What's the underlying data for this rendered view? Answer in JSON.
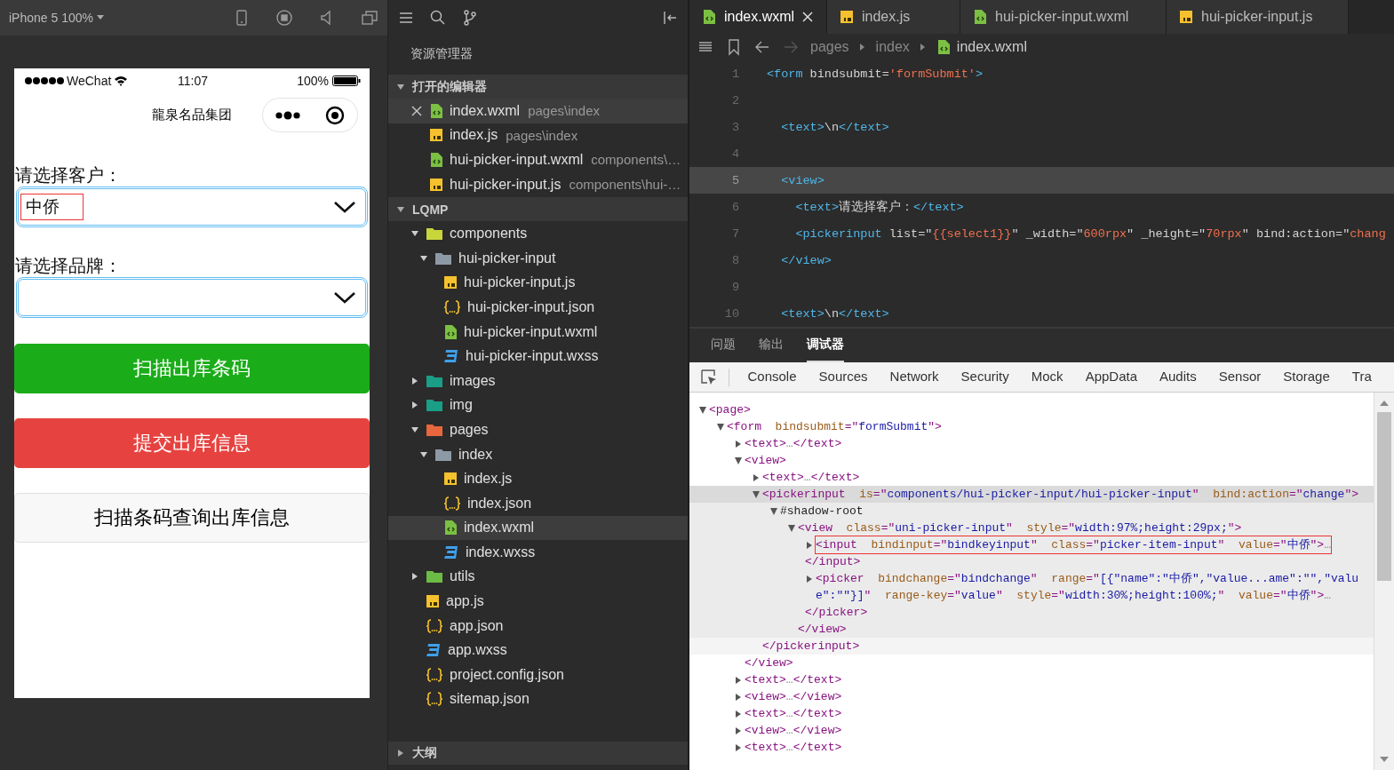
{
  "simulator": {
    "device_label": "iPhone 5 100%",
    "status_bar": {
      "carrier": "WeChat",
      "time": "11:07",
      "battery": "100%"
    },
    "nav_title": "龍泉名品集团",
    "fields": [
      {
        "label": "请选择客户：",
        "value": "中侨",
        "outlined": true
      },
      {
        "label": "请选择品牌：",
        "outlined": false
      }
    ],
    "buttons": [
      {
        "label": "扫描出库条码",
        "kind": "primary"
      },
      {
        "label": "提交出库信息",
        "kind": "warn"
      },
      {
        "label": "扫描条码查询出库信息",
        "kind": "default"
      }
    ]
  },
  "explorer": {
    "title": "资源管理器",
    "open_editors": {
      "title": "打开的编辑器",
      "expanded": true,
      "items": [
        {
          "name": "index.wxml",
          "path": "pages\\index",
          "kind": "wxml",
          "selected": true
        },
        {
          "name": "index.js",
          "path": "pages\\index",
          "kind": "js",
          "selected": false
        },
        {
          "name": "hui-picker-input.wxml",
          "path": "components\\…",
          "kind": "wxml",
          "selected": false
        },
        {
          "name": "hui-picker-input.js",
          "path": "components\\hui-…",
          "kind": "js",
          "selected": false
        }
      ]
    },
    "project": {
      "title": "LQMP",
      "expanded": true,
      "items": [
        {
          "name": "components",
          "kind": "folder",
          "color": "#c8d63c",
          "expanded": true,
          "selected": false,
          "children": [
            {
              "name": "hui-picker-input",
              "kind": "folder",
              "color": "#8d9aa5",
              "expanded": true,
              "selected": false,
              "children": [
                {
                  "name": "hui-picker-input.js",
                  "kind": "js",
                  "selected": false
                },
                {
                  "name": "hui-picker-input.json",
                  "kind": "json",
                  "selected": false
                },
                {
                  "name": "hui-picker-input.wxml",
                  "kind": "wxml",
                  "selected": false
                },
                {
                  "name": "hui-picker-input.wxss",
                  "kind": "wxss",
                  "selected": false
                }
              ]
            }
          ]
        },
        {
          "name": "images",
          "kind": "folder",
          "color": "#1a9e86",
          "expanded": false,
          "selected": false
        },
        {
          "name": "img",
          "kind": "folder",
          "color": "#1a9e86",
          "expanded": false,
          "selected": false
        },
        {
          "name": "pages",
          "kind": "folder",
          "color": "#e8673c",
          "expanded": true,
          "selected": false,
          "children": [
            {
              "name": "index",
              "kind": "folder",
              "color": "#8d9aa5",
              "expanded": true,
              "selected": false,
              "children": [
                {
                  "name": "index.js",
                  "kind": "js",
                  "selected": false
                },
                {
                  "name": "index.json",
                  "kind": "json",
                  "selected": false
                },
                {
                  "name": "index.wxml",
                  "kind": "wxml",
                  "selected": true
                },
                {
                  "name": "index.wxss",
                  "kind": "wxss",
                  "selected": false
                }
              ]
            }
          ]
        },
        {
          "name": "utils",
          "kind": "folder",
          "color": "#6cbb45",
          "expanded": false,
          "selected": false
        },
        {
          "name": "app.js",
          "kind": "js",
          "selected": false
        },
        {
          "name": "app.json",
          "kind": "json",
          "selected": false
        },
        {
          "name": "app.wxss",
          "kind": "wxss",
          "selected": false
        },
        {
          "name": "project.config.json",
          "kind": "json",
          "selected": false
        },
        {
          "name": "sitemap.json",
          "kind": "json",
          "selected": false
        }
      ]
    },
    "outline": {
      "title": "大纲",
      "expanded": false
    }
  },
  "editor": {
    "tabs": [
      {
        "label": "index.wxml",
        "kind": "wxml",
        "selected": true
      },
      {
        "label": "index.js",
        "kind": "js",
        "selected": false
      },
      {
        "label": "hui-picker-input.wxml",
        "kind": "wxml",
        "selected": false
      },
      {
        "label": "hui-picker-input.js",
        "kind": "js",
        "selected": false
      }
    ],
    "breadcrumb": [
      {
        "label": "pages"
      },
      {
        "label": "index"
      },
      {
        "label": "index.wxml",
        "kind": "wxml"
      }
    ],
    "lines": [
      {
        "number": "1",
        "current": false,
        "tokens": [
          {
            "kind": "tag",
            "text": "<form"
          },
          {
            "kind": "plain",
            "text": " bindsubmit="
          },
          {
            "kind": "str",
            "text": "'formSubmit'"
          },
          {
            "kind": "tag",
            "text": ">"
          }
        ]
      },
      {
        "number": "2",
        "current": false
      },
      {
        "number": "3",
        "current": false,
        "tokens": [
          {
            "kind": "tag",
            "text": "  <text>"
          },
          {
            "kind": "plain",
            "text": "\\n"
          },
          {
            "kind": "tag",
            "text": "</text>"
          }
        ]
      },
      {
        "number": "4",
        "current": false
      },
      {
        "number": "5",
        "current": true,
        "tokens": [
          {
            "kind": "tag",
            "text": "  <view>"
          }
        ]
      },
      {
        "number": "6",
        "current": false,
        "tokens": [
          {
            "kind": "tag",
            "text": "    <text>"
          },
          {
            "kind": "plain",
            "text": "请选择客户："
          },
          {
            "kind": "tag",
            "text": "</text>"
          }
        ]
      },
      {
        "number": "7",
        "current": false,
        "tokens": [
          {
            "kind": "tag",
            "text": "    <pickerinput"
          },
          {
            "kind": "plain",
            "text": " list=\""
          },
          {
            "kind": "str",
            "text": "{{select1}}"
          },
          {
            "kind": "plain",
            "text": "\" _width=\""
          },
          {
            "kind": "str",
            "text": "600rpx"
          },
          {
            "kind": "plain",
            "text": "\" _height=\""
          },
          {
            "kind": "str",
            "text": "70rpx"
          },
          {
            "kind": "plain",
            "text": "\" bind:action=\""
          },
          {
            "kind": "str",
            "text": "chang"
          }
        ]
      },
      {
        "number": "8",
        "current": false,
        "tokens": [
          {
            "kind": "tag",
            "text": "  </view>"
          }
        ]
      },
      {
        "number": "9",
        "current": false
      },
      {
        "number": "10",
        "current": false,
        "tokens": [
          {
            "kind": "tag",
            "text": "  <text>"
          },
          {
            "kind": "plain",
            "text": "\\n"
          },
          {
            "kind": "tag",
            "text": "</text>"
          }
        ]
      }
    ]
  },
  "panel": {
    "tabs": [
      {
        "label": "问题",
        "selected": false
      },
      {
        "label": "输出",
        "selected": false
      },
      {
        "label": "调试器",
        "selected": true
      }
    ],
    "devtools_tabs": [
      {
        "label": "Console",
        "selected": false
      },
      {
        "label": "Sources",
        "selected": false
      },
      {
        "label": "Network",
        "selected": false
      },
      {
        "label": "Security",
        "selected": false
      },
      {
        "label": "Mock",
        "selected": false
      },
      {
        "label": "AppData",
        "selected": false
      },
      {
        "label": "Audits",
        "selected": false
      },
      {
        "label": "Sensor",
        "selected": false
      },
      {
        "label": "Storage",
        "selected": false
      },
      {
        "label": "Tra",
        "selected": false
      }
    ],
    "dom_tree": [
      {
        "tokens": [
          {
            "kind": "tag",
            "text": "<page>"
          }
        ],
        "expanded": true,
        "selected": false,
        "children": [
          {
            "tokens": [
              {
                "kind": "tag",
                "text": "<form"
              },
              {
                "kind": "attr",
                "text": "  bindsubmit"
              },
              {
                "kind": "tag",
                "text": "=\""
              },
              {
                "kind": "val",
                "text": "formSubmit"
              },
              {
                "kind": "tag",
                "text": "\">"
              }
            ],
            "expanded": true,
            "selected": false,
            "children": [
              {
                "tokens": [
                  {
                    "kind": "tag",
                    "text": "<text>"
                  },
                  {
                    "kind": "ell",
                    "text": "…"
                  },
                  {
                    "kind": "tag",
                    "text": "</text>"
                  }
                ],
                "expanded": false,
                "selected": false
              },
              {
                "tokens": [
                  {
                    "kind": "tag",
                    "text": "<view>"
                  }
                ],
                "expanded": true,
                "selected": false,
                "close": "</view>",
                "children": [
                  {
                    "tokens": [
                      {
                        "kind": "tag",
                        "text": "<text>"
                      },
                      {
                        "kind": "ell",
                        "text": "…"
                      },
                      {
                        "kind": "tag",
                        "text": "</text>"
                      }
                    ],
                    "expanded": false,
                    "selected": false
                  },
                  {
                    "tokens": [
                      {
                        "kind": "tag",
                        "text": "<pickerinput"
                      },
                      {
                        "kind": "attr",
                        "text": "  is"
                      },
                      {
                        "kind": "tag",
                        "text": "=\""
                      },
                      {
                        "kind": "val",
                        "text": "components/hui-picker-input/hui-picker-input"
                      },
                      {
                        "kind": "tag",
                        "text": "\""
                      },
                      {
                        "kind": "attr",
                        "text": "  bind:action"
                      },
                      {
                        "kind": "tag",
                        "text": "=\""
                      },
                      {
                        "kind": "val",
                        "text": "change"
                      },
                      {
                        "kind": "tag",
                        "text": "\">"
                      }
                    ],
                    "expanded": true,
                    "selected": true,
                    "close": "</pickerinput>",
                    "children": [
                      {
                        "tokens": [
                          {
                            "kind": "text",
                            "text": "#shadow-root"
                          }
                        ],
                        "expanded": true,
                        "selected": false,
                        "children": [
                          {
                            "tokens": [
                              {
                                "kind": "tag",
                                "text": "<view"
                              },
                              {
                                "kind": "attr",
                                "text": "  class"
                              },
                              {
                                "kind": "tag",
                                "text": "=\""
                              },
                              {
                                "kind": "val",
                                "text": "uni-picker-input"
                              },
                              {
                                "kind": "tag",
                                "text": "\""
                              },
                              {
                                "kind": "attr",
                                "text": "  style"
                              },
                              {
                                "kind": "tag",
                                "text": "=\""
                              },
                              {
                                "kind": "val",
                                "text": "width:97%;height:29px;"
                              },
                              {
                                "kind": "tag",
                                "text": "\">"
                              }
                            ],
                            "expanded": true,
                            "selected": false,
                            "close": "</view>",
                            "children": [
                              {
                                "tokens": [
                                  {
                                    "kind": "tag",
                                    "text": "<input"
                                  },
                                  {
                                    "kind": "attr",
                                    "text": "  bindinput"
                                  },
                                  {
                                    "kind": "tag",
                                    "text": "=\""
                                  },
                                  {
                                    "kind": "val",
                                    "text": "bindkeyinput"
                                  },
                                  {
                                    "kind": "tag",
                                    "text": "\""
                                  },
                                  {
                                    "kind": "attr",
                                    "text": "  class"
                                  },
                                  {
                                    "kind": "tag",
                                    "text": "=\""
                                  },
                                  {
                                    "kind": "val",
                                    "text": "picker-item-input"
                                  },
                                  {
                                    "kind": "tag",
                                    "text": "\""
                                  },
                                  {
                                    "kind": "attr",
                                    "text": "  value"
                                  },
                                  {
                                    "kind": "tag",
                                    "text": "=\""
                                  },
                                  {
                                    "kind": "val",
                                    "text": "中侨"
                                  },
                                  {
                                    "kind": "tag",
                                    "text": "\">"
                                  },
                                  {
                                    "kind": "ell",
                                    "text": "…"
                                  }
                                ],
                                "expanded": false,
                                "selected": false,
                                "outlined": true,
                                "close": "</input>"
                              },
                              {
                                "tokens": [
                                  {
                                    "kind": "tag",
                                    "text": "<picker"
                                  },
                                  {
                                    "kind": "attr",
                                    "text": "  bindchange"
                                  },
                                  {
                                    "kind": "tag",
                                    "text": "=\""
                                  },
                                  {
                                    "kind": "val",
                                    "text": "bindchange"
                                  },
                                  {
                                    "kind": "tag",
                                    "text": "\""
                                  },
                                  {
                                    "kind": "attr",
                                    "text": "  range"
                                  },
                                  {
                                    "kind": "tag",
                                    "text": "=\""
                                  },
                                  {
                                    "kind": "val",
                                    "text": "[{\"name\":\"中侨\",\"value...ame\":\"\",\"value\":\"\"}]"
                                  },
                                  {
                                    "kind": "tag",
                                    "text": "\""
                                  },
                                  {
                                    "kind": "attr",
                                    "text": "  range-key"
                                  },
                                  {
                                    "kind": "tag",
                                    "text": "=\""
                                  },
                                  {
                                    "kind": "val",
                                    "text": "value"
                                  },
                                  {
                                    "kind": "tag",
                                    "text": "\""
                                  },
                                  {
                                    "kind": "attr",
                                    "text": "  style"
                                  },
                                  {
                                    "kind": "tag",
                                    "text": "=\""
                                  },
                                  {
                                    "kind": "val",
                                    "text": "width:30%;height:100%;"
                                  },
                                  {
                                    "kind": "tag",
                                    "text": "\""
                                  },
                                  {
                                    "kind": "attr",
                                    "text": "  value"
                                  },
                                  {
                                    "kind": "tag",
                                    "text": "=\""
                                  },
                                  {
                                    "kind": "val",
                                    "text": "中侨"
                                  },
                                  {
                                    "kind": "tag",
                                    "text": "\">"
                                  },
                                  {
                                    "kind": "ell",
                                    "text": "…"
                                  }
                                ],
                                "expanded": false,
                                "selected": false,
                                "close": "</picker>"
                              }
                            ]
                          }
                        ]
                      }
                    ]
                  }
                ]
              },
              {
                "tokens": [
                  {
                    "kind": "tag",
                    "text": "<text>"
                  },
                  {
                    "kind": "ell",
                    "text": "…"
                  },
                  {
                    "kind": "tag",
                    "text": "</text>"
                  }
                ],
                "expanded": false,
                "selected": false
              },
              {
                "tokens": [
                  {
                    "kind": "tag",
                    "text": "<view>"
                  },
                  {
                    "kind": "ell",
                    "text": "…"
                  },
                  {
                    "kind": "tag",
                    "text": "</view>"
                  }
                ],
                "expanded": false,
                "selected": false
              },
              {
                "tokens": [
                  {
                    "kind": "tag",
                    "text": "<text>"
                  },
                  {
                    "kind": "ell",
                    "text": "…"
                  },
                  {
                    "kind": "tag",
                    "text": "</text>"
                  }
                ],
                "expanded": false,
                "selected": false
              },
              {
                "tokens": [
                  {
                    "kind": "tag",
                    "text": "<view>"
                  },
                  {
                    "kind": "ell",
                    "text": "…"
                  },
                  {
                    "kind": "tag",
                    "text": "</view>"
                  }
                ],
                "expanded": false,
                "selected": false
              },
              {
                "tokens": [
                  {
                    "kind": "tag",
                    "text": "<text>"
                  },
                  {
                    "kind": "ell",
                    "text": "…"
                  },
                  {
                    "kind": "tag",
                    "text": "</text>"
                  }
                ],
                "expanded": false,
                "selected": false
              }
            ]
          }
        ]
      }
    ]
  }
}
